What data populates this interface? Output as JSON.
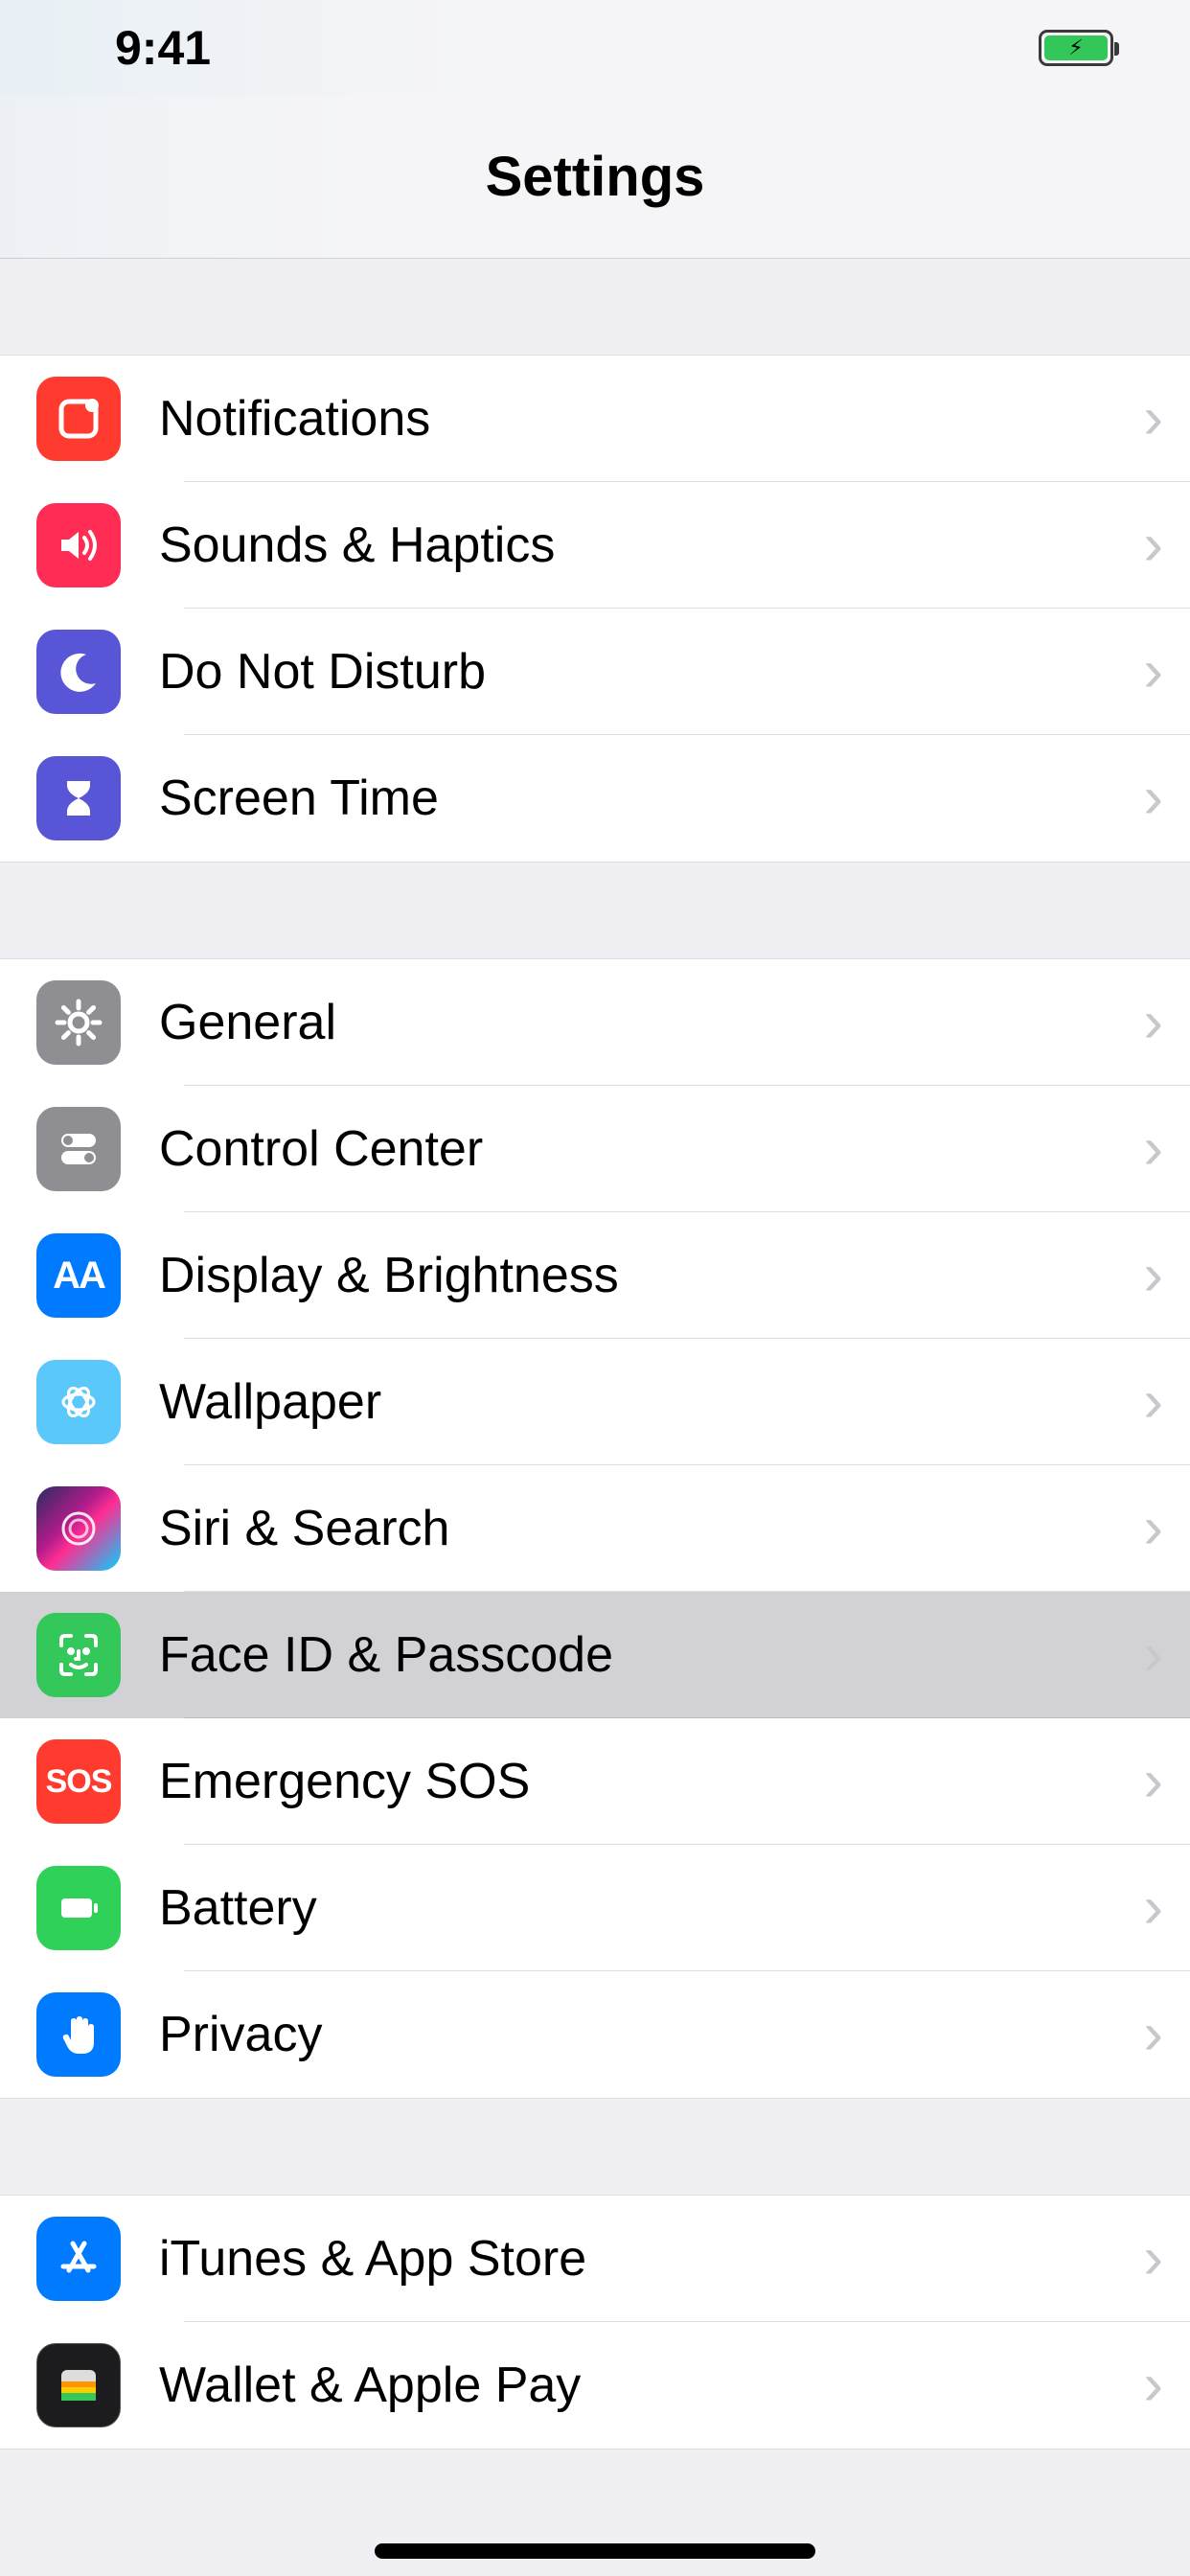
{
  "statusBar": {
    "time": "9:41"
  },
  "nav": {
    "title": "Settings"
  },
  "groups": [
    {
      "key": "g1",
      "items": [
        {
          "key": "notifications",
          "label": "Notifications",
          "iconName": "notification-icon",
          "iconColor": "bg-red",
          "highlighted": false
        },
        {
          "key": "sounds",
          "label": "Sounds & Haptics",
          "iconName": "speaker-icon",
          "iconColor": "bg-pink",
          "highlighted": false
        },
        {
          "key": "dnd",
          "label": "Do Not Disturb",
          "iconName": "moon-icon",
          "iconColor": "bg-purple",
          "highlighted": false
        },
        {
          "key": "screentime",
          "label": "Screen Time",
          "iconName": "hourglass-icon",
          "iconColor": "bg-purple",
          "highlighted": false
        }
      ]
    },
    {
      "key": "g2",
      "items": [
        {
          "key": "general",
          "label": "General",
          "iconName": "gear-icon",
          "iconColor": "bg-gray",
          "highlighted": false
        },
        {
          "key": "control-center",
          "label": "Control Center",
          "iconName": "toggles-icon",
          "iconColor": "bg-gray",
          "highlighted": false
        },
        {
          "key": "display",
          "label": "Display & Brightness",
          "iconName": "brightness-icon",
          "iconColor": "bg-blue",
          "highlighted": false
        },
        {
          "key": "wallpaper",
          "label": "Wallpaper",
          "iconName": "flower-icon",
          "iconColor": "bg-teal",
          "highlighted": false
        },
        {
          "key": "siri",
          "label": "Siri & Search",
          "iconName": "siri-icon",
          "iconColor": "bg-siri",
          "highlighted": false
        },
        {
          "key": "faceid",
          "label": "Face ID & Passcode",
          "iconName": "faceid-icon",
          "iconColor": "bg-green",
          "highlighted": true
        },
        {
          "key": "sos",
          "label": "Emergency SOS",
          "iconName": "sos-icon",
          "iconColor": "bg-red",
          "highlighted": false
        },
        {
          "key": "battery",
          "label": "Battery",
          "iconName": "battery-icon",
          "iconColor": "bg-green2",
          "highlighted": false
        },
        {
          "key": "privacy",
          "label": "Privacy",
          "iconName": "hand-icon",
          "iconColor": "bg-blue",
          "highlighted": false
        }
      ]
    },
    {
      "key": "g3",
      "items": [
        {
          "key": "itunes",
          "label": "iTunes & App Store",
          "iconName": "appstore-icon",
          "iconColor": "bg-blue",
          "highlighted": false
        },
        {
          "key": "wallet",
          "label": "Wallet & Apple Pay",
          "iconName": "wallet-icon",
          "iconColor": "bg-black",
          "highlighted": false
        }
      ]
    }
  ]
}
